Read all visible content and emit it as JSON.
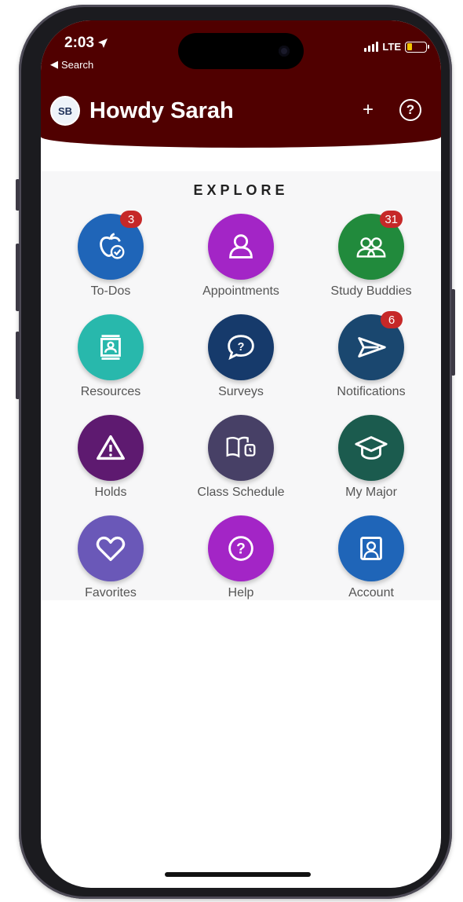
{
  "status_bar": {
    "time": "2:03",
    "back_label": "Search",
    "network": "LTE"
  },
  "header": {
    "avatar_initials": "SB",
    "greeting": "Howdy Sarah",
    "add_icon": "plus-icon",
    "help_icon": "question-circle-icon",
    "background": "#500000"
  },
  "explore": {
    "title": "EXPLORE",
    "tiles": [
      {
        "label": "To-Dos",
        "icon": "apple-check-icon",
        "color": "#1f65b8",
        "badge": "3"
      },
      {
        "label": "Appointments",
        "icon": "person-icon",
        "color": "#a325c6",
        "badge": ""
      },
      {
        "label": "Study Buddies",
        "icon": "group-icon",
        "color": "#218a3c",
        "badge": "31"
      },
      {
        "label": "Resources",
        "icon": "id-card-icon",
        "color": "#28b8ac",
        "badge": ""
      },
      {
        "label": "Surveys",
        "icon": "speech-question-icon",
        "color": "#163a6b",
        "badge": ""
      },
      {
        "label": "Notifications",
        "icon": "send-icon",
        "color": "#1a476f",
        "badge": "6"
      },
      {
        "label": "Holds",
        "icon": "warning-icon",
        "color": "#5e1a70",
        "badge": ""
      },
      {
        "label": "Class Schedule",
        "icon": "book-watch-icon",
        "color": "#474066",
        "badge": ""
      },
      {
        "label": "My Major",
        "icon": "graduation-cap-icon",
        "color": "#1b5b4e",
        "badge": ""
      },
      {
        "label": "Favorites",
        "icon": "heart-icon",
        "color": "#6a58b8",
        "badge": ""
      },
      {
        "label": "Help",
        "icon": "question-icon",
        "color": "#a325c6",
        "badge": ""
      },
      {
        "label": "Account",
        "icon": "account-portrait-icon",
        "color": "#1f65b8",
        "badge": ""
      }
    ]
  }
}
